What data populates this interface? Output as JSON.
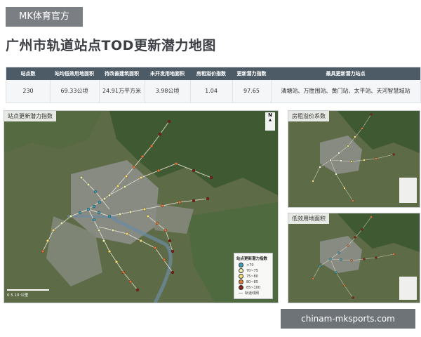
{
  "brand": {
    "label": "MK体育官方"
  },
  "title": "广州市轨道站点TOD更新潜力地图",
  "stats": {
    "headers": [
      "站点数",
      "站均低效用地面积",
      "待改善建筑面积",
      "未开发用地面积",
      "房租溢价指数",
      "更新潜力指数",
      "最具更新潜力站点"
    ],
    "values": [
      "230",
      "69.33公顷",
      "24.91万平方米",
      "3.98公顷",
      "1.04",
      "97.65",
      "清塘站、万胜围站、黄门站、太平站、天河智慧城站"
    ]
  },
  "maps": {
    "main_label": "站点更新潜力指数",
    "rent_label": "房租溢价系数",
    "land_label": "低效用地面积",
    "north": "N",
    "scale_text": "0   5   10 公里",
    "legend": {
      "title": "站点更新潜力指数",
      "items": [
        {
          "label": "<70",
          "color": "#3a9fb8"
        },
        {
          "label": "70~75",
          "color": "#e9efb0"
        },
        {
          "label": "75~80",
          "color": "#f7e07a"
        },
        {
          "label": "80~85",
          "color": "#e47a3a"
        },
        {
          "label": "85~100",
          "color": "#8a1e18"
        }
      ],
      "line_label": "轨道线网"
    }
  },
  "watermark": "chinam-mksports.com"
}
